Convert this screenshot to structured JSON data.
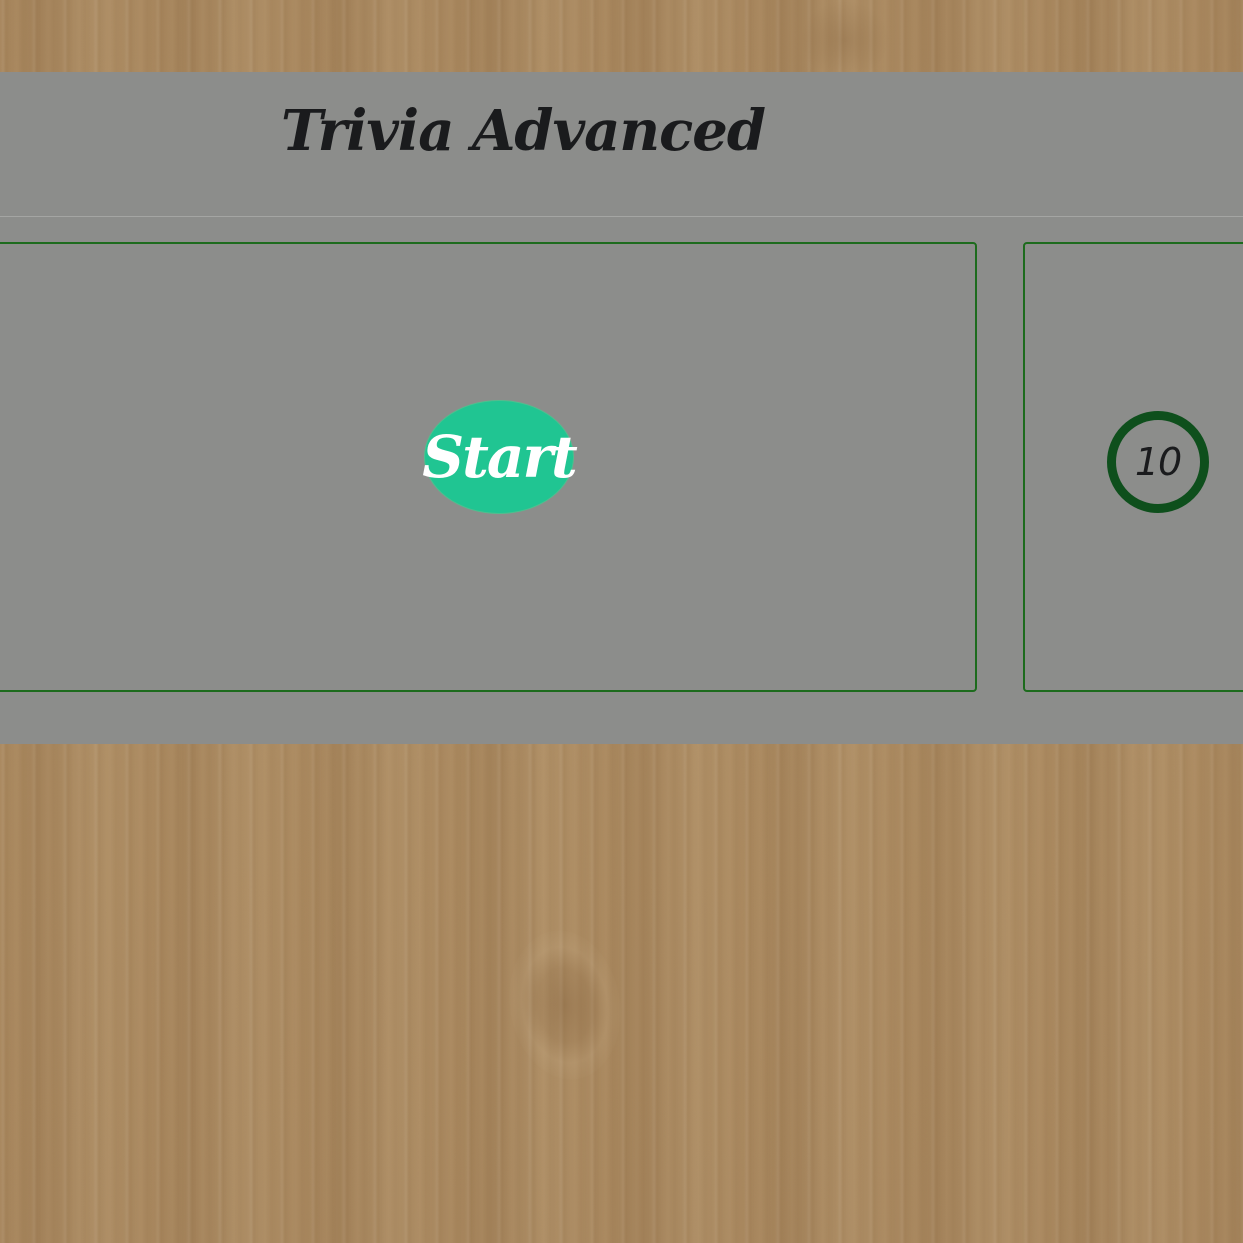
{
  "app": {
    "title": "Trivia Advanced"
  },
  "question_area": {
    "start_button_label": "Start"
  },
  "timer": {
    "value": "10"
  },
  "colors": {
    "panel": "#8c8d8b",
    "border": "#1d6b1d",
    "start_button": "#20c592",
    "timer_ring": "#0e4f1c",
    "title_text": "#1a1b1d"
  }
}
